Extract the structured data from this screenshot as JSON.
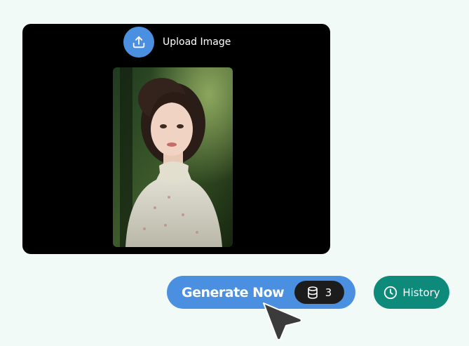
{
  "upload": {
    "label": "Upload Image",
    "icon": "upload-icon"
  },
  "generate": {
    "label": "Generate Now",
    "credits": "3",
    "icon": "database-icon"
  },
  "history": {
    "label": "History",
    "icon": "clock-icon"
  },
  "colors": {
    "background": "#f1faf6",
    "primary": "#4a8fe0",
    "history": "#0e8a7b",
    "panel": "#000000",
    "pill": "#1c1c1c"
  }
}
